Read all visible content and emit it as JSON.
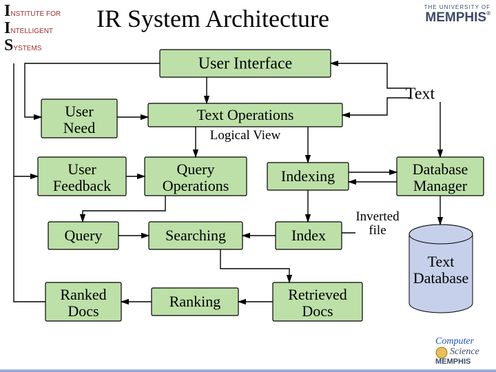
{
  "logo_left": {
    "line1_initial": "I",
    "line1_rest": "NSTITUTE for",
    "line2_initial": "I",
    "line2_rest": "NTELLIGENT",
    "line3_initial": "S",
    "line3_rest": "YSTEMS"
  },
  "logo_right": {
    "uni": "THE UNIVERSITY OF",
    "name": "MEMPHIS",
    "tm": "®"
  },
  "title": "IR System Architecture",
  "nodes": {
    "user_interface": "User Interface",
    "user_need_l1": "User",
    "user_need_l2": "Need",
    "text_operations": "Text Operations",
    "logical_view": "Logical View",
    "user_feedback_l1": "User",
    "user_feedback_l2": "Feedback",
    "query_ops_l1": "Query",
    "query_ops_l2": "Operations",
    "indexing": "Indexing",
    "db_manager_l1": "Database",
    "db_manager_l2": "Manager",
    "query": "Query",
    "searching": "Searching",
    "index": "Index",
    "inverted_l1": "Inverted",
    "inverted_l2": "file",
    "text": "Text",
    "ranked_l1": "Ranked",
    "ranked_l2": "Docs",
    "ranking": "Ranking",
    "retrieved_l1": "Retrieved",
    "retrieved_l2": "Docs",
    "text_db_l1": "Text",
    "text_db_l2": "Database"
  },
  "colors": {
    "box_fill": "#bde0a8",
    "cylinder_fill": "#c6d0ea"
  },
  "corner_badge": {
    "line1": "Computer",
    "line2": "Science",
    "mem": "MEMPHIS"
  }
}
